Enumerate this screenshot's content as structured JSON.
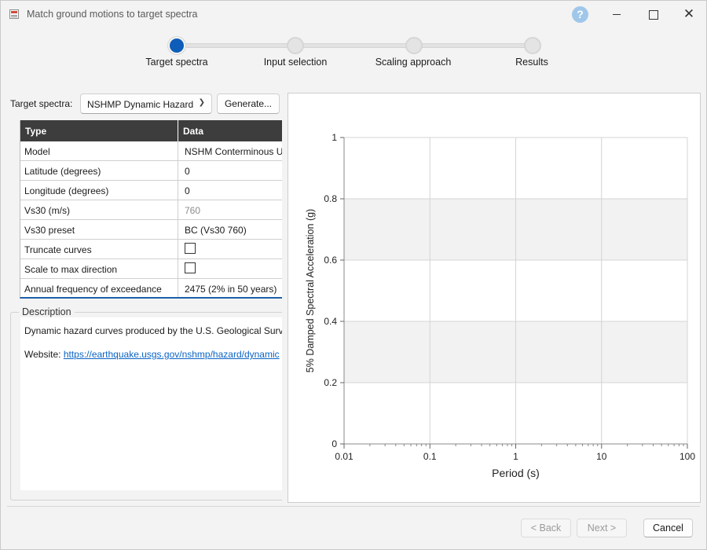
{
  "window": {
    "title": "Match ground motions to target spectra",
    "help_glyph": "?",
    "close_glyph": "✕"
  },
  "stepper": {
    "steps": [
      {
        "label": "Target spectra",
        "active": true
      },
      {
        "label": "Input selection",
        "active": false
      },
      {
        "label": "Scaling approach",
        "active": false
      },
      {
        "label": "Results",
        "active": false
      }
    ]
  },
  "target": {
    "label": "Target spectra:",
    "selected": "NSHMP Dynamic Hazard",
    "generate_label": "Generate..."
  },
  "table": {
    "headers": {
      "type": "Type",
      "data": "Data"
    },
    "rows": [
      {
        "type": "Model",
        "data": "NSHM Conterminous U.S."
      },
      {
        "type": "Latitude (degrees)",
        "data": "0"
      },
      {
        "type": "Longitude (degrees)",
        "data": "0"
      },
      {
        "type": "Vs30 (m/s)",
        "data": "760"
      },
      {
        "type": "Vs30 preset",
        "data": "BC (Vs30 760)"
      },
      {
        "type": "Truncate curves",
        "data": ""
      },
      {
        "type": "Scale to max direction",
        "data": ""
      },
      {
        "type": "Annual frequency of exceedance",
        "data": "2475 (2% in 50 years)"
      }
    ]
  },
  "description": {
    "legend": "Description",
    "text": "Dynamic hazard curves produced by the U.S. Geological Survey",
    "website_label": "Website:",
    "website_url": "https://earthquake.usgs.gov/nshmp/hazard/dynamic"
  },
  "chart_data": {
    "type": "line",
    "series": [],
    "xlabel": "Period (s)",
    "ylabel": "5% Damped Spectral Acceleration (g)",
    "xscale": "log",
    "xlim": [
      0.01,
      100
    ],
    "ylim": [
      0,
      1
    ],
    "xticks": [
      "0.01",
      "0.1",
      "1",
      "10",
      "100"
    ],
    "yticks": [
      "0",
      "0.2",
      "0.4",
      "0.6",
      "0.8",
      "1"
    ],
    "grid": true,
    "band_color": "#f2f2f2"
  },
  "footer": {
    "back_label": "< Back",
    "next_label": "Next >",
    "cancel_label": "Cancel"
  }
}
